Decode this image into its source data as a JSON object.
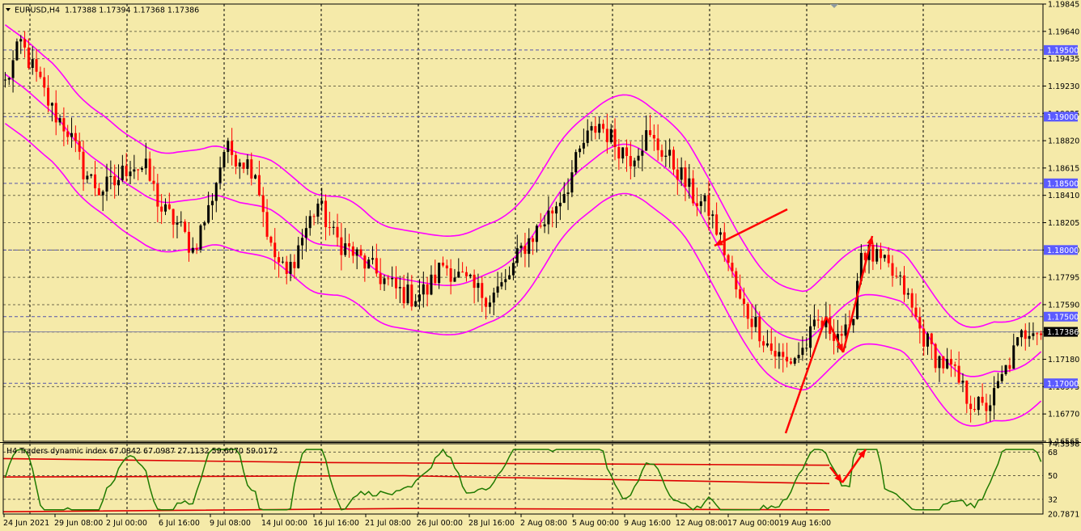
{
  "header": {
    "symbol": "EURUSD,H4",
    "ohlc": "1.17388 1.17394 1.17368 1.17386"
  },
  "indicator": {
    "title": "H4 Traders dynamic index 67.0842 67.0987 27.1132 59.6070 59.0172",
    "scale": [
      "74.3598",
      "68",
      "50",
      "32",
      "20.7871"
    ],
    "levels": [
      68,
      50,
      32
    ],
    "range": [
      20.7871,
      74.3598
    ]
  },
  "colors": {
    "background": "#f5eaa9",
    "grid": "#000000",
    "bull_candle": "#000000",
    "bear_candle": "#ff0000",
    "envelope": "#ff00ff",
    "level_line": "#5555aa",
    "price_tag": "#5b5bff",
    "current_tag": "#000000",
    "arrows": "#ff0000",
    "oscillator": "#1f7a00",
    "indicator_bands": "#dd0000"
  },
  "chart_data": {
    "type": "candlestick",
    "title": "EURUSD,H4",
    "x_labels": [
      "24 Jun 2021",
      "29 Jun 08:00",
      "2 Jul 00:00",
      "6 Jul 16:00",
      "9 Jul 08:00",
      "14 Jul 00:00",
      "16 Jul 16:00",
      "21 Jul 08:00",
      "26 Jul 00:00",
      "28 Jul 16:00",
      "2 Aug 08:00",
      "5 Aug 00:00",
      "9 Aug 16:00",
      "12 Aug 08:00",
      "17 Aug 00:00",
      "19 Aug 16:00"
    ],
    "y_labels": [
      "1.19845",
      "1.19640",
      "1.19435",
      "1.19230",
      "1.19025",
      "1.18820",
      "1.18615",
      "1.18410",
      "1.18205",
      "1.18000",
      "1.17795",
      "1.17590",
      "1.17385",
      "1.17180",
      "1.16975",
      "1.16770",
      "1.16565"
    ],
    "ylim": [
      1.16565,
      1.19845
    ],
    "level_tags": [
      "1.19500",
      "1.19000",
      "1.18500",
      "1.18000",
      "1.17500",
      "1.17000"
    ],
    "current_price": "1.17386",
    "close_path": [
      [
        0,
        1.1925
      ],
      [
        4,
        1.1955
      ],
      [
        8,
        1.193
      ],
      [
        12,
        1.1905
      ],
      [
        16,
        1.189
      ],
      [
        20,
        1.186
      ],
      [
        24,
        1.1845
      ],
      [
        28,
        1.185
      ],
      [
        32,
        1.1865
      ],
      [
        36,
        1.186
      ],
      [
        40,
        1.183
      ],
      [
        44,
        1.182
      ],
      [
        48,
        1.18
      ],
      [
        52,
        1.183
      ],
      [
        56,
        1.1875
      ],
      [
        60,
        1.187
      ],
      [
        64,
        1.186
      ],
      [
        68,
        1.18
      ],
      [
        72,
        1.178
      ],
      [
        76,
        1.181
      ],
      [
        80,
        1.1835
      ],
      [
        84,
        1.181
      ],
      [
        88,
        1.18
      ],
      [
        92,
        1.179
      ],
      [
        96,
        1.178
      ],
      [
        100,
        1.177
      ],
      [
        104,
        1.1765
      ],
      [
        108,
        1.177
      ],
      [
        112,
        1.179
      ],
      [
        116,
        1.178
      ],
      [
        120,
        1.177
      ],
      [
        124,
        1.1765
      ],
      [
        128,
        1.1775
      ],
      [
        132,
        1.18
      ],
      [
        136,
        1.1815
      ],
      [
        140,
        1.183
      ],
      [
        144,
        1.185
      ],
      [
        148,
        1.188
      ],
      [
        152,
        1.1895
      ],
      [
        156,
        1.188
      ],
      [
        160,
        1.187
      ],
      [
        164,
        1.1885
      ],
      [
        168,
        1.1875
      ],
      [
        172,
        1.186
      ],
      [
        176,
        1.184
      ],
      [
        180,
        1.183
      ],
      [
        184,
        1.18
      ],
      [
        188,
        1.176
      ],
      [
        192,
        1.1745
      ],
      [
        196,
        1.1725
      ],
      [
        200,
        1.1715
      ],
      [
        204,
        1.1725
      ],
      [
        208,
        1.1745
      ],
      [
        212,
        1.174
      ],
      [
        216,
        1.1735
      ],
      [
        219,
        1.18
      ],
      [
        222,
        1.1795
      ],
      [
        226,
        1.1785
      ],
      [
        230,
        1.177
      ],
      [
        234,
        1.174
      ],
      [
        238,
        1.172
      ],
      [
        242,
        1.171
      ],
      [
        246,
        1.169
      ],
      [
        250,
        1.168
      ],
      [
        253,
        1.169
      ],
      [
        256,
        1.171
      ],
      [
        260,
        1.1735
      ],
      [
        263,
        1.1745
      ],
      [
        265,
        1.1739
      ]
    ],
    "annotations": [
      "arrow to swing high near 1.1800 on 12 Aug",
      "trend line from 1.1665 to 1.1750",
      "projected zig-zag: pullback then rise toward 1.1820"
    ]
  }
}
